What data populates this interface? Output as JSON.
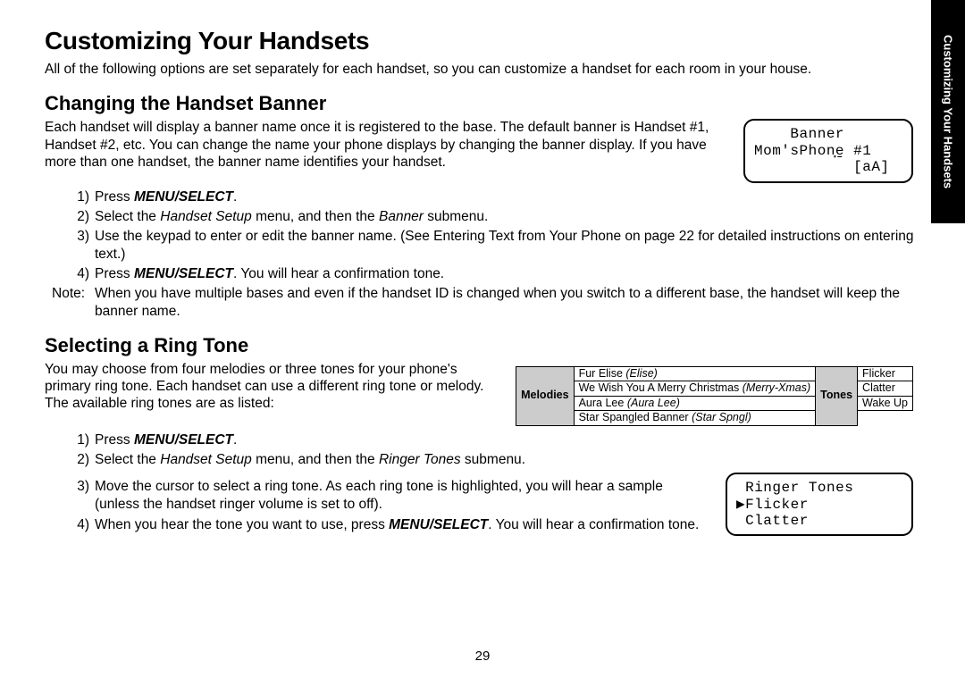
{
  "sideTab": "Customizing Your Handsets",
  "h1": "Customizing Your Handsets",
  "intro": "All of the following options are set separately for each handset, so you can customize a handset for each room in your house.",
  "banner": {
    "heading": "Changing the Handset Banner",
    "para": "Each handset will display a banner name once it is registered to the base. The default banner is Handset #1, Handset #2, etc. You can change the name your phone displays by changing the banner display. If you have more than one handset, the banner name identifies your handset.",
    "lcd": {
      "line1": "    Banner",
      "line2": "Mom'sPhon̟e̠ #1",
      "line3": "           [aA]"
    },
    "steps": [
      {
        "n": "1)",
        "pre": "Press ",
        "bi": "MENU/SELECT",
        "post": "."
      },
      {
        "n": "2)",
        "runs": [
          {
            "t": "Select the "
          },
          {
            "t": "Handset Setup",
            "cls": "em"
          },
          {
            "t": " menu, and then the "
          },
          {
            "t": "Banner",
            "cls": "em"
          },
          {
            "t": " submenu."
          }
        ]
      },
      {
        "n": "3)",
        "runs": [
          {
            "t": "Use the keypad to enter or edit the banner name. (See Entering Text from Your Phone on page 22 for detailed instructions on entering text.)"
          }
        ]
      },
      {
        "n": "4)",
        "runs": [
          {
            "t": "Press "
          },
          {
            "t": "MENU/SELECT",
            "cls": "bi"
          },
          {
            "t": ". You will hear a confirmation tone."
          }
        ]
      }
    ],
    "noteLabel": "Note:",
    "noteBody": "When you have multiple bases and even if the handset ID is changed when you switch to a different base, the handset will keep the banner name."
  },
  "ring": {
    "heading": "Selecting a Ring Tone",
    "para": "You may choose from four melodies or three tones for your phone's primary ring tone. Each handset can use a different ring tone or melody. The available ring tones are as listed:",
    "table": {
      "melHeader": "Melodies",
      "mel": [
        {
          "name": "Fur Elise ",
          "paren": "(Elise)"
        },
        {
          "name": "We Wish You A Merry Christmas ",
          "paren": "(Merry-Xmas)"
        },
        {
          "name": "Aura Lee ",
          "paren": "(Aura Lee)"
        },
        {
          "name": "Star Spangled Banner ",
          "paren": "(Star Spngl)"
        }
      ],
      "toneHeader": "Tones",
      "tones": [
        "Flicker",
        "Clatter",
        "Wake Up"
      ]
    },
    "steps12": [
      {
        "n": "1)",
        "runs": [
          {
            "t": "Press "
          },
          {
            "t": "MENU/SELECT",
            "cls": "bi"
          },
          {
            "t": "."
          }
        ]
      },
      {
        "n": "2)",
        "runs": [
          {
            "t": "Select the "
          },
          {
            "t": "Handset Setup",
            "cls": "em"
          },
          {
            "t": " menu, and then the "
          },
          {
            "t": "Ringer Tones",
            "cls": "em"
          },
          {
            "t": " submenu."
          }
        ]
      }
    ],
    "steps34": [
      {
        "n": "3)",
        "runs": [
          {
            "t": "Move the cursor to select a ring tone. As each ring tone is highlighted, you will hear a sample (unless the handset ringer volume is set to off)."
          }
        ]
      },
      {
        "n": "4)",
        "runs": [
          {
            "t": "When you hear the tone you want to use, press "
          },
          {
            "t": "MENU/SELECT",
            "cls": "bi"
          },
          {
            "t": ". You will hear a confirmation tone."
          }
        ]
      }
    ],
    "lcd": {
      "line1": " Ringer Tones",
      "line2": "▶Flicker",
      "line3": " Clatter"
    }
  },
  "pageNumber": "29"
}
